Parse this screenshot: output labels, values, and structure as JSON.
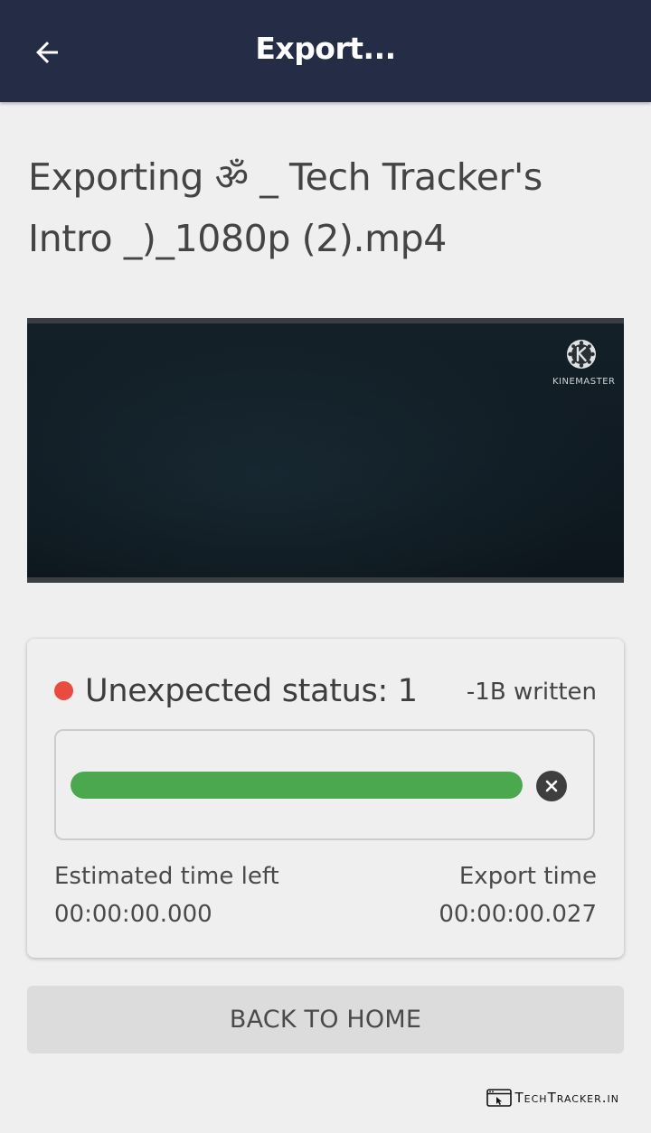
{
  "app_bar": {
    "title": "Export...",
    "back_icon": "arrow-left-icon",
    "background": "#252c45"
  },
  "export": {
    "heading": "Exporting ॐ _ Tech Tracker's Intro _)_1080p (2).mp4"
  },
  "preview": {
    "logo_text": "KINEMASTER",
    "logo_icon": "kinemaster-logo-icon"
  },
  "status": {
    "dot_color": "#e94b41",
    "text": "Unexpected status: 1",
    "written": "-1B written",
    "progress_fraction": 1.0,
    "progress_color": "#4ba84f",
    "cancel_icon": "close-icon",
    "estimated_label": "Estimated time left",
    "estimated_value": "00:00:00.000",
    "export_label": "Export time",
    "export_value": "00:00:00.027"
  },
  "actions": {
    "back_home_label": "BACK TO HOME"
  },
  "watermark": {
    "text": "TechTracker.in",
    "icon": "browser-window-icon"
  }
}
